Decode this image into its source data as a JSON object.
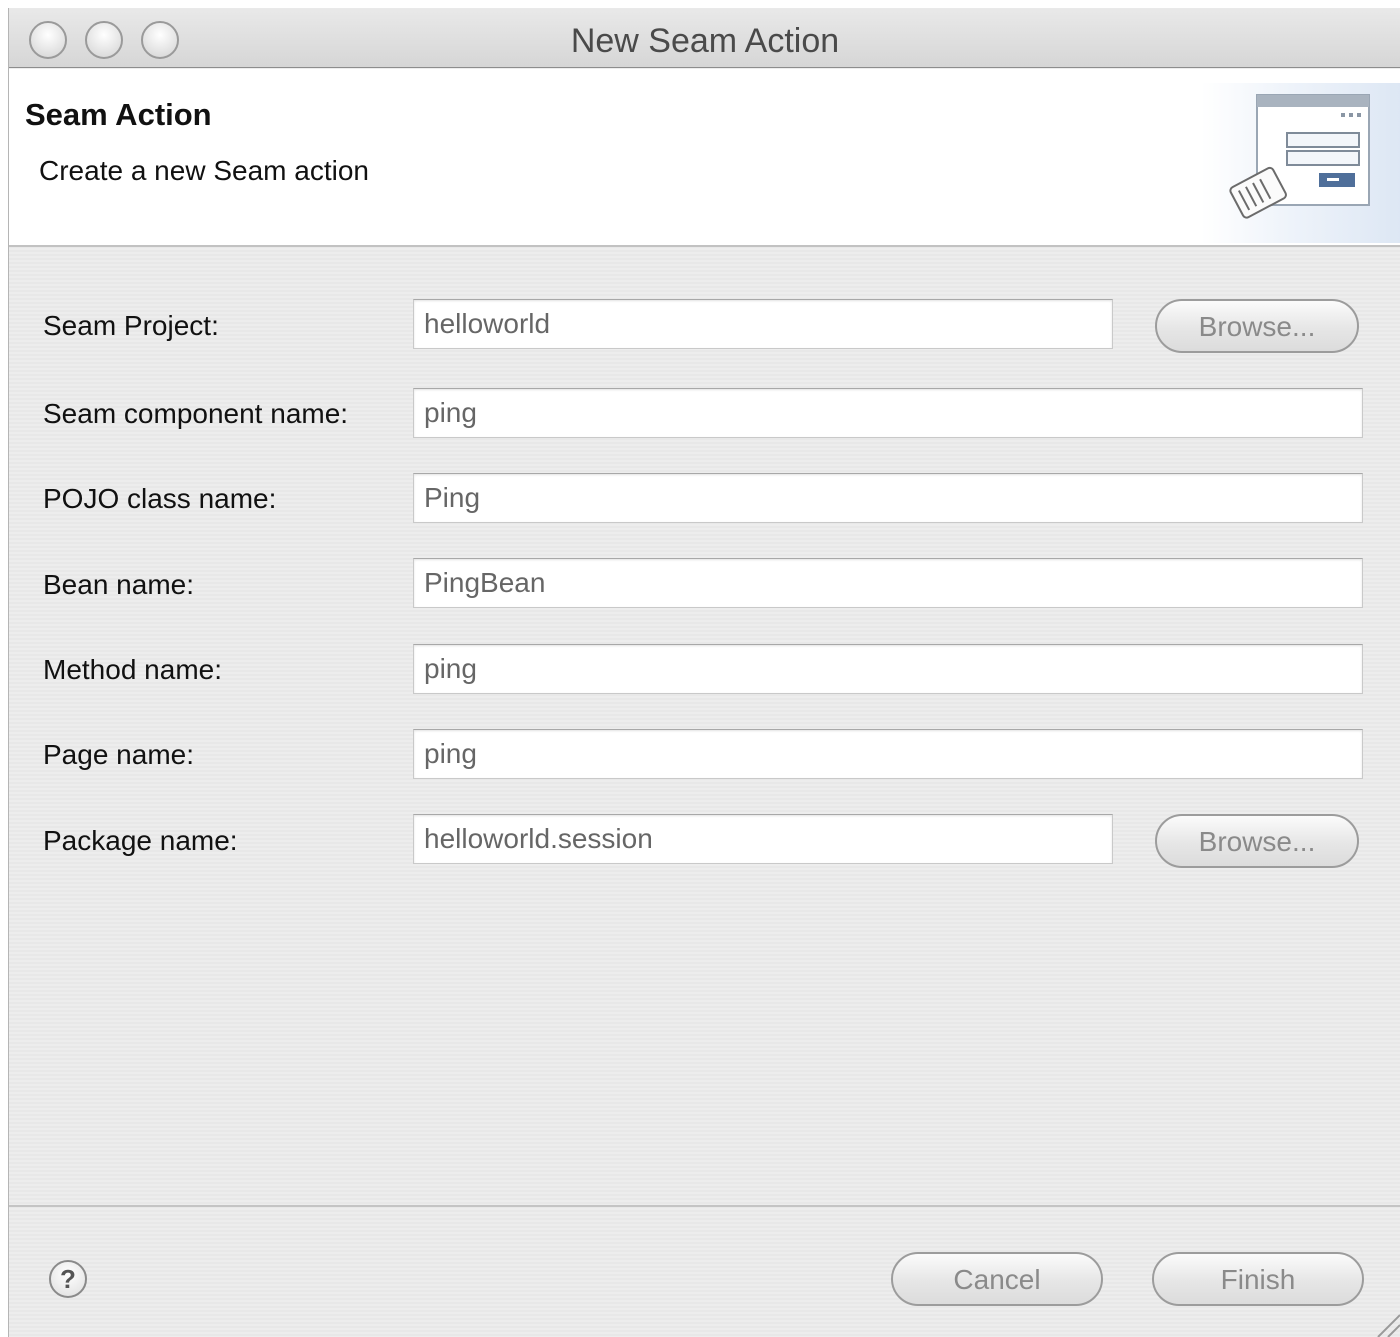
{
  "window": {
    "title": "New Seam Action"
  },
  "banner": {
    "title": "Seam Action",
    "description": "Create a new Seam action"
  },
  "form": {
    "seam_project": {
      "label": "Seam Project:",
      "value": "helloworld",
      "browse_label": "Browse..."
    },
    "component_name": {
      "label": "Seam component name:",
      "value": "ping"
    },
    "pojo_class": {
      "label": "POJO class name:",
      "value": "Ping"
    },
    "bean_name": {
      "label": "Bean name:",
      "value": "PingBean"
    },
    "method_name": {
      "label": "Method name:",
      "value": "ping"
    },
    "page_name": {
      "label": "Page name:",
      "value": "ping"
    },
    "package_name": {
      "label": "Package name:",
      "value": "helloworld.session",
      "browse_label": "Browse..."
    }
  },
  "footer": {
    "help_symbol": "?",
    "cancel_label": "Cancel",
    "finish_label": "Finish"
  },
  "icons": {
    "close": "close-button-icon",
    "minimize": "minimize-button-icon",
    "zoom": "zoom-button-icon",
    "wizard": "wizard-banner-icon",
    "help": "help-icon",
    "resize": "resize-grip-icon"
  }
}
